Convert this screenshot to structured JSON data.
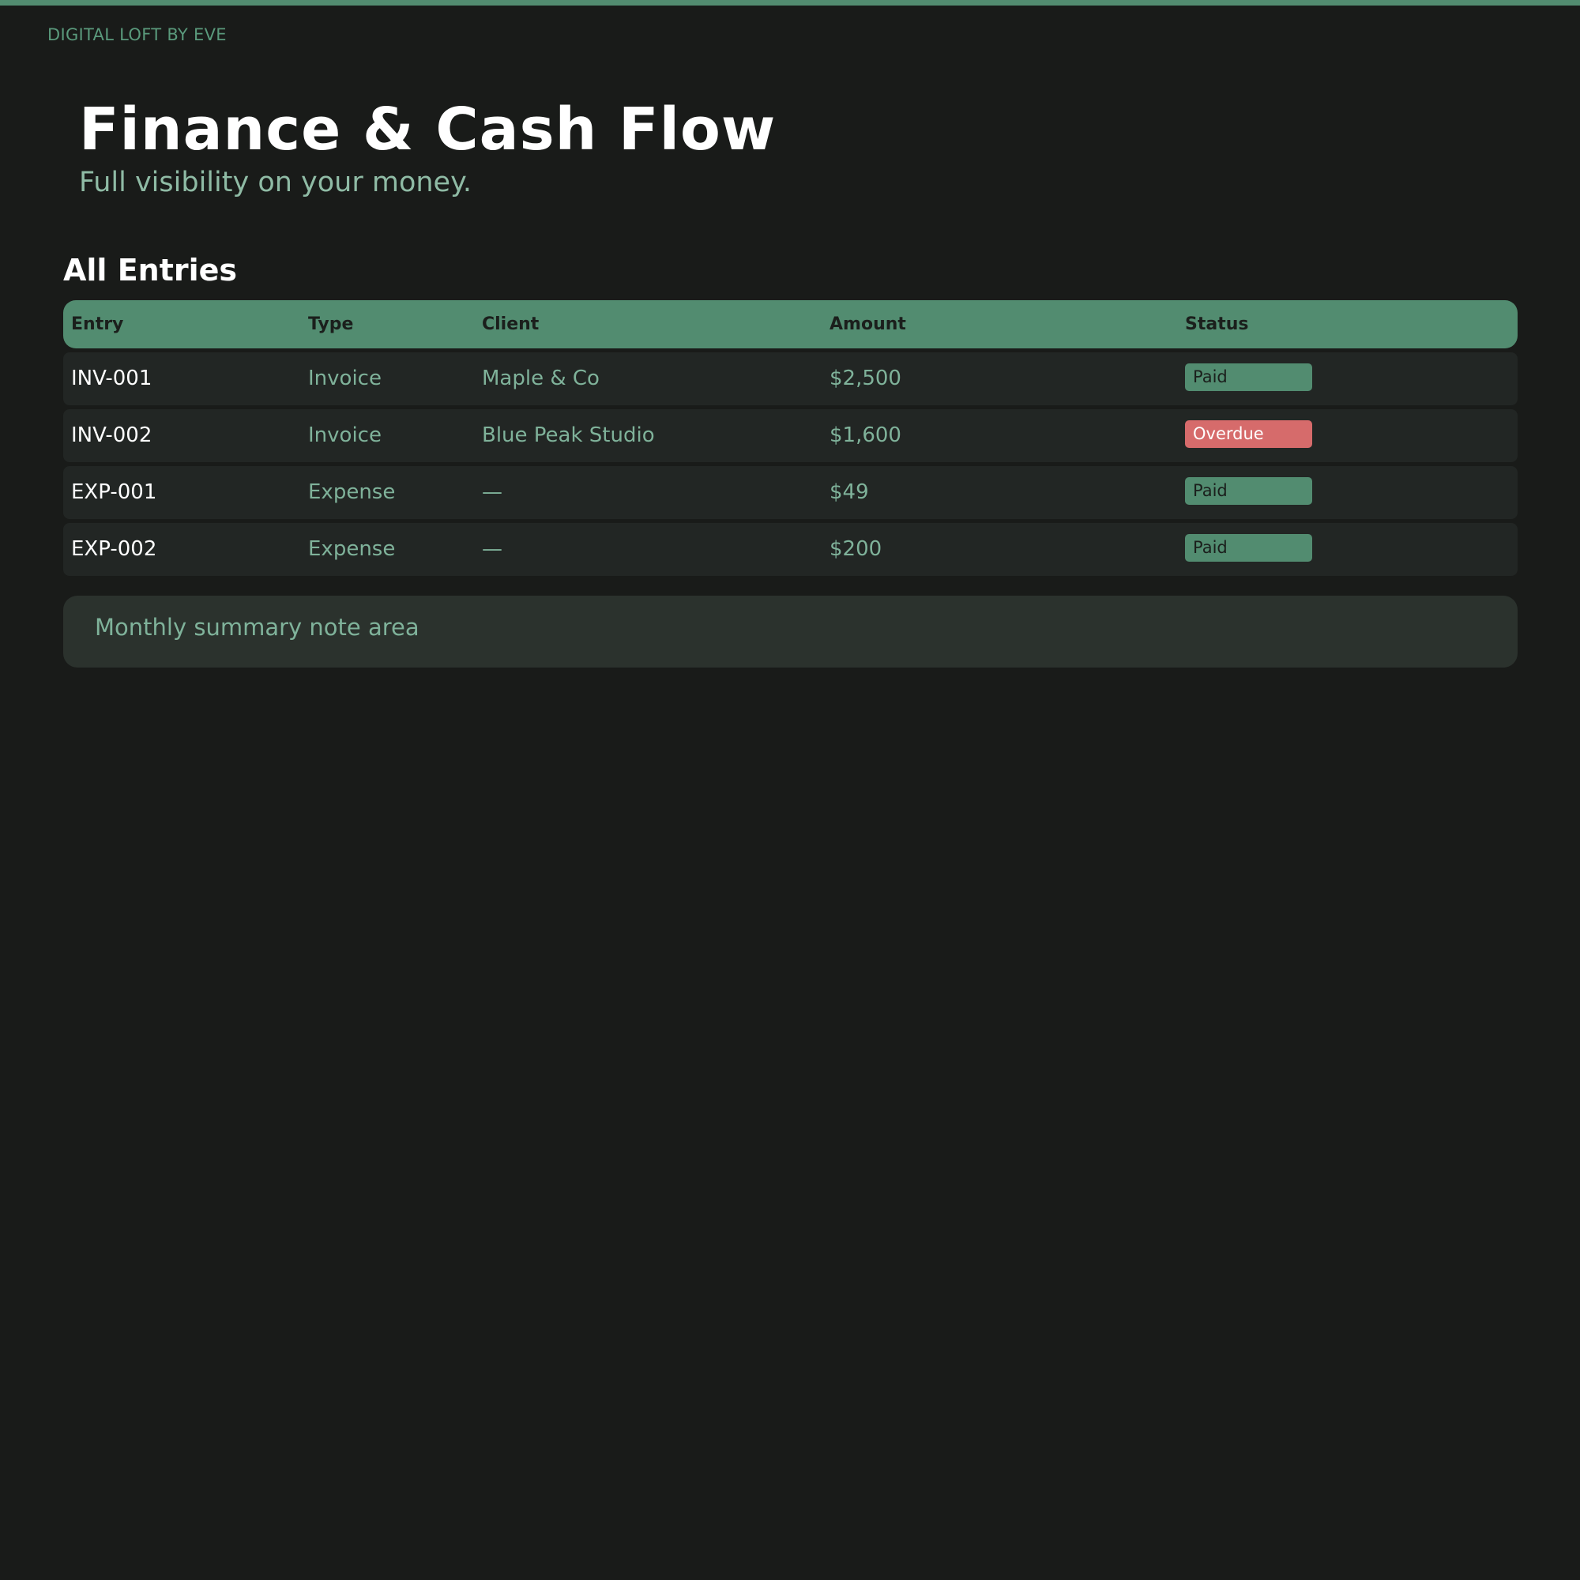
{
  "brand": "DIGITAL LOFT BY EVE",
  "header": {
    "title": "Finance & Cash Flow",
    "subtitle": "Full visibility on your money."
  },
  "section": {
    "title": "All Entries"
  },
  "table": {
    "columns": [
      "Entry",
      "Type",
      "Client",
      "Amount",
      "Status"
    ],
    "rows": [
      {
        "entry": "INV-001",
        "type": "Invoice",
        "client": "Maple & Co",
        "amount": "$2,500",
        "status": "Paid"
      },
      {
        "entry": "INV-002",
        "type": "Invoice",
        "client": "Blue Peak Studio",
        "amount": "$1,600",
        "status": "Overdue"
      },
      {
        "entry": "EXP-001",
        "type": "Expense",
        "client": "—",
        "amount": "$49",
        "status": "Paid"
      },
      {
        "entry": "EXP-002",
        "type": "Expense",
        "client": "—",
        "amount": "$200",
        "status": "Paid"
      }
    ]
  },
  "note": {
    "placeholder": "Monthly summary note area"
  },
  "colors": {
    "accent": "#528c70",
    "background": "#191b19",
    "overdue": "#d66b6b",
    "muted_text": "#7fb29a"
  }
}
